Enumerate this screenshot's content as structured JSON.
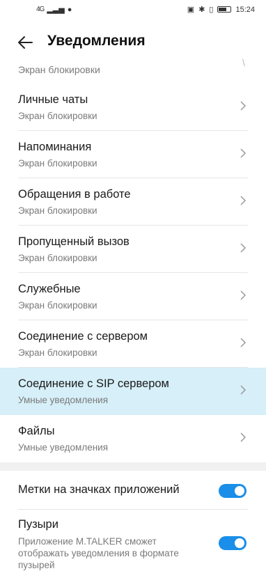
{
  "status_bar": {
    "network": "4G",
    "time": "15:24"
  },
  "header": {
    "title": "Уведомления"
  },
  "list": {
    "cut_item_subtitle": "Экран блокировки",
    "items": [
      {
        "label": "Личные чаты",
        "subtitle": "Экран блокировки"
      },
      {
        "label": "Напоминания",
        "subtitle": "Экран блокировки"
      },
      {
        "label": "Обращения в работе",
        "subtitle": "Экран блокировки"
      },
      {
        "label": "Пропущенный вызов",
        "subtitle": "Экран блокировки"
      },
      {
        "label": "Служебные",
        "subtitle": "Экран блокировки"
      },
      {
        "label": "Соединение с сервером",
        "subtitle": "Экран блокировки"
      },
      {
        "label": "Соединение с SIP сервером",
        "subtitle": "Умные уведомления"
      },
      {
        "label": "Файлы",
        "subtitle": "Умные уведомления"
      }
    ]
  },
  "toggles": {
    "badges": {
      "label": "Метки на значках приложений",
      "on": true
    },
    "bubbles": {
      "label": "Пузыри",
      "description": "Приложение M.TALKER сможет отображать уведомления в формате пузырей",
      "on": true
    }
  },
  "colors": {
    "accent": "#1a8ee8",
    "highlight": "#d6eff8"
  }
}
